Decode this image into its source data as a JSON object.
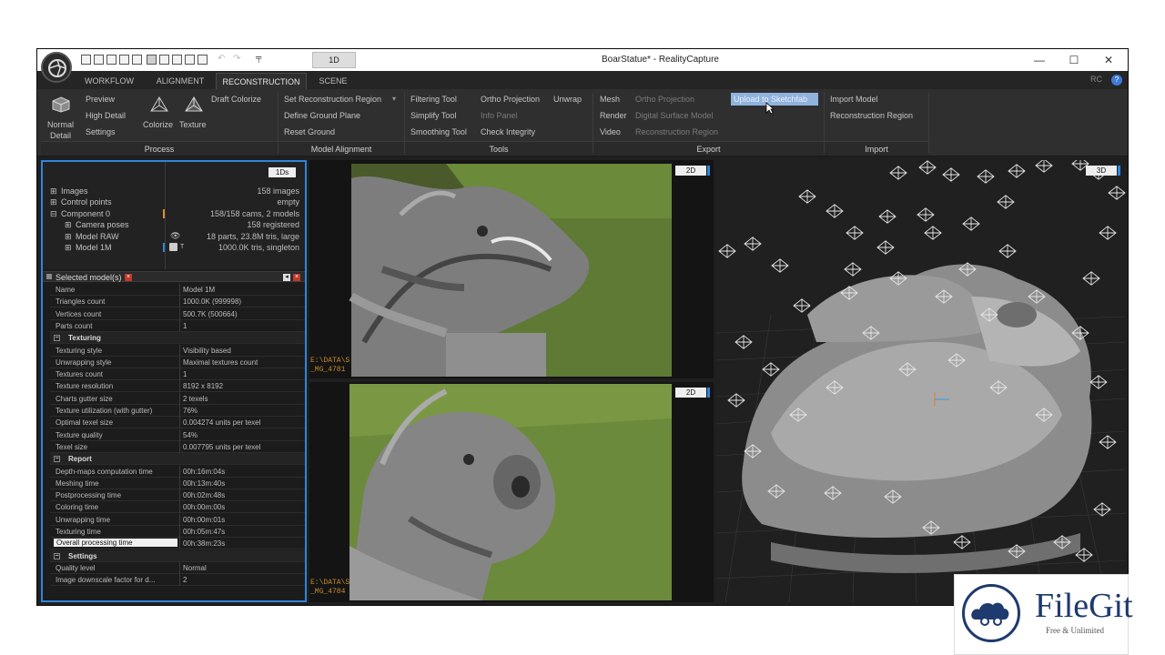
{
  "window": {
    "title": "BoarStatue* - RealityCapture",
    "tab": "1D",
    "rc": "RC",
    "help": "?"
  },
  "tabs": [
    "WORKFLOW",
    "ALIGNMENT",
    "RECONSTRUCTION",
    "SCENE"
  ],
  "active_tab": "RECONSTRUCTION",
  "ribbon": {
    "process": {
      "label": "Process",
      "normal_detail": "Normal\nDetail",
      "normal": "Normal",
      "detail": "Detail",
      "preview": "Preview",
      "high_detail": "High Detail",
      "settings": "Settings",
      "colorize": "Colorize",
      "texture": "Texture",
      "draft_colorize": "Draft Colorize"
    },
    "model_alignment": {
      "label": "Model Alignment",
      "set_region": "Set Reconstruction Region",
      "define_ground": "Define Ground Plane",
      "reset_ground": "Reset Ground"
    },
    "tools": {
      "label": "Tools",
      "filtering": "Filtering Tool",
      "simplify": "Simplify Tool",
      "smoothing": "Smoothing Tool",
      "ortho": "Ortho Projection",
      "unwrap": "Unwrap",
      "info": "Info Panel",
      "check": "Check Integrity"
    },
    "export": {
      "label": "Export",
      "mesh": "Mesh",
      "render": "Render",
      "video": "Video",
      "ortho_proj": "Ortho Projection",
      "dsm": "Digital Surface Model",
      "recon_region": "Reconstruction Region",
      "upload": "Upload to Sketchfab"
    },
    "import": {
      "label": "Import",
      "import_model": "Import Model",
      "recon_region": "Reconstruction Region"
    }
  },
  "tree": {
    "badge": "1Ds",
    "items": [
      {
        "label": "Images",
        "value": "158 images"
      },
      {
        "label": "Control points",
        "value": "empty"
      },
      {
        "label": "Component 0",
        "value": "158/158 cams, 2 models"
      },
      {
        "label": "Camera poses",
        "value": "158 registered"
      },
      {
        "label": "Model RAW",
        "value": "18 parts, 23.8M tris, large"
      },
      {
        "label": "Model 1M",
        "value": "1000.0K tris, singleton"
      }
    ]
  },
  "selected": {
    "header": "Selected model(s)",
    "rows": [
      {
        "k": "Name",
        "v": "Model 1M"
      },
      {
        "k": "Triangles count",
        "v": "1000.0K (999998)"
      },
      {
        "k": "Vertices count",
        "v": "500.7K (500664)"
      },
      {
        "k": "Parts count",
        "v": "1"
      },
      {
        "k": "Texturing",
        "v": "",
        "section": true
      },
      {
        "k": "Texturing style",
        "v": "Visibility based"
      },
      {
        "k": "Unwrapping style",
        "v": "Maximal textures count"
      },
      {
        "k": "Textures count",
        "v": "1"
      },
      {
        "k": "Texture resolution",
        "v": "8192 x 8192"
      },
      {
        "k": "Charts gutter size",
        "v": "2 texels"
      },
      {
        "k": "Texture utilization (with gutter)",
        "v": "76%"
      },
      {
        "k": "Optimal texel size",
        "v": "0.004274 units per texel"
      },
      {
        "k": "Texture quality",
        "v": "54%"
      },
      {
        "k": "Texel size",
        "v": "0.007795 units per texel"
      },
      {
        "k": "Report",
        "v": "",
        "section": true
      },
      {
        "k": "Depth-maps computation time",
        "v": "00h:16m:04s"
      },
      {
        "k": "Meshing time",
        "v": "00h:13m:40s"
      },
      {
        "k": "Postprocessing time",
        "v": "00h:02m:48s"
      },
      {
        "k": "Coloring time",
        "v": "00h:00m:00s"
      },
      {
        "k": "Unwrapping time",
        "v": "00h:00m:01s"
      },
      {
        "k": "Texturing time",
        "v": "00h:05m:47s"
      },
      {
        "k": "Overall processing time",
        "v": "00h:38m:23s",
        "highlight": true
      },
      {
        "k": "Settings",
        "v": "",
        "section": true
      },
      {
        "k": "Quality level",
        "v": "Normal"
      },
      {
        "k": "Image downscale factor for d...",
        "v": "2"
      }
    ]
  },
  "views": {
    "top_badge": "2D",
    "bottom_badge": "2D",
    "right_badge": "3D",
    "top_path": "E:\\DATA\\S\n_MG_4781",
    "bottom_path": "E:\\DATA\\S\n_MG_4784"
  },
  "watermark": {
    "name": "FileGit",
    "tagline": "Free & Unlimited"
  },
  "colors": {
    "accent": "#2e86de",
    "panel": "#1f1f1f",
    "ribbon": "#2f2f2f"
  }
}
